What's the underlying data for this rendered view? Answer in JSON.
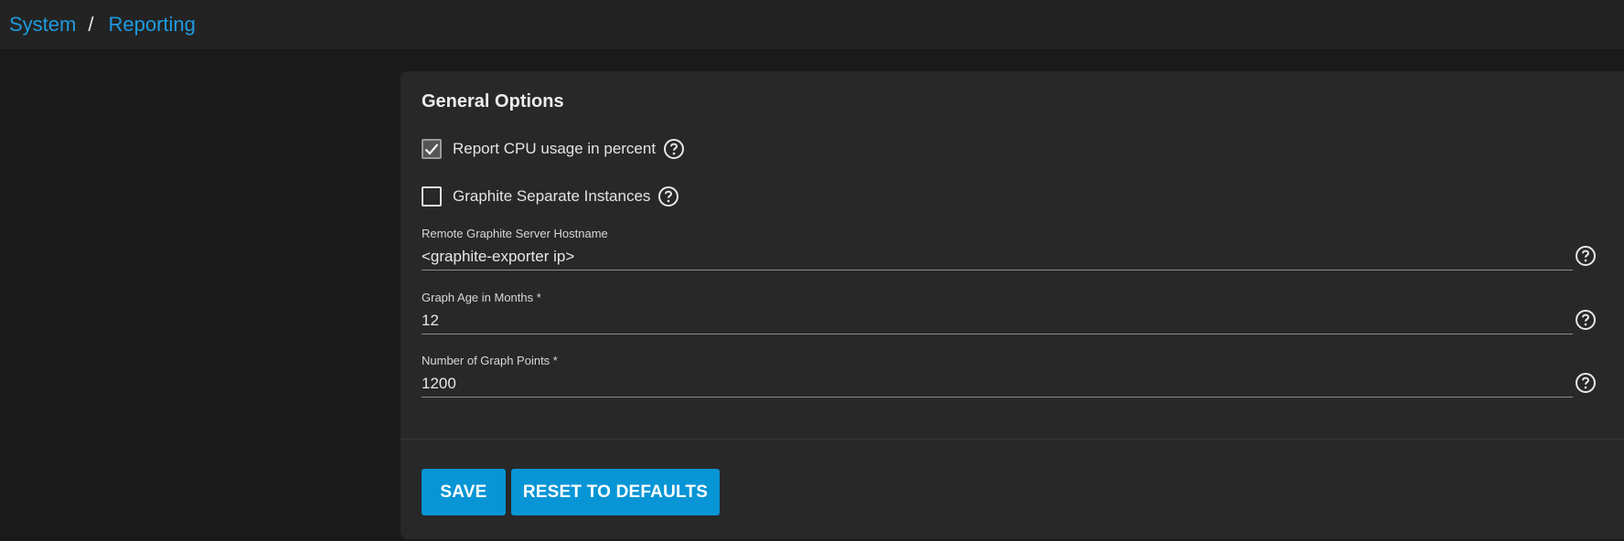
{
  "breadcrumb": {
    "items": [
      "System",
      "Reporting"
    ],
    "separator": "/"
  },
  "card": {
    "title": "General Options",
    "checkboxes": [
      {
        "label": "Report CPU usage in percent",
        "checked": true
      },
      {
        "label": "Graphite Separate Instances",
        "checked": false
      }
    ],
    "fields": [
      {
        "label": "Remote Graphite Server Hostname",
        "value": "<graphite-exporter ip>"
      },
      {
        "label": "Graph Age in Months *",
        "value": "12"
      },
      {
        "label": "Number of Graph Points *",
        "value": "1200"
      }
    ],
    "buttons": {
      "save": "SAVE",
      "reset": "RESET TO DEFAULTS"
    }
  },
  "icons": {
    "help": "help-circle-icon",
    "check": "checkmark-icon"
  },
  "colors": {
    "accent": "#0895d5",
    "link": "#1e9be0",
    "background": "#1a1a1a",
    "card": "#282828",
    "topbar": "#232323"
  }
}
